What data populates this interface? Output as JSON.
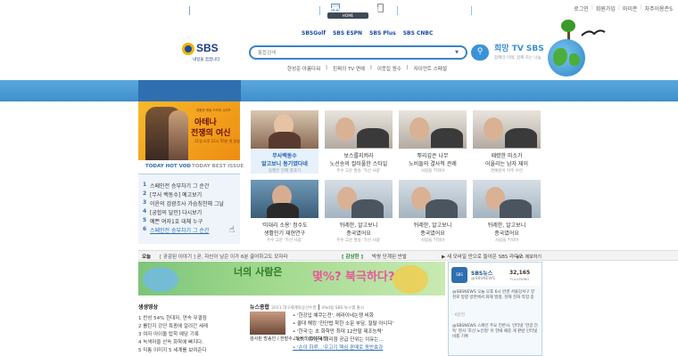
{
  "top": {
    "home_tab": "HOME",
    "links": [
      "로그인",
      "회원가입",
      "마이존",
      "자주이용존S"
    ]
  },
  "header": {
    "logo": "SBS",
    "logo_sub": "내일을 꿈꿉니다",
    "brands": [
      "SBSGolf",
      "SBS ESPN",
      "SBS Plus",
      "SBS CNBC"
    ],
    "search_placeholder": "통합검색",
    "quicklinks": [
      "한성준 아름다워",
      "진짜의 TV 연예",
      "이웃집 원수",
      "자이언트 스페셜"
    ],
    "hope_title": "희망 TV SBS",
    "hope_sub": "함께라 미래, 함께 하는 나눔"
  },
  "nav": {
    "left": [
      "온에어",
      "편성표"
    ],
    "group1": [
      "TV",
      "라디오",
      "뉴스"
    ],
    "group2": [
      "NeTV",
      "VOD",
      "콘텐"
    ],
    "group3": [
      "뮤직",
      "게임",
      "영화"
    ],
    "group4": [
      "프로그램 바로가기"
    ]
  },
  "promo": {
    "line": "영원한 애정 드라마 시리즈",
    "title1": "아테나",
    "title2": "전쟁의 여신",
    "sub": "11일 오후 11시 55분 첫 방송"
  },
  "tabs": {
    "left": "TODAY HOT VOD",
    "right": "TODAY BEST ISSUE"
  },
  "ranking": [
    {
      "n": "1",
      "t": "스페인전 승부차기 그 순간"
    },
    {
      "n": "2",
      "t": "[무사 백동수] 예고보기"
    },
    {
      "n": "3",
      "t": "이윤의 검광조사 가슴칭찬해 그날"
    },
    {
      "n": "4",
      "t": "[궁합의 달인] 다시보기"
    },
    {
      "n": "5",
      "t": "예쁜 여자1호 대체 누구"
    },
    {
      "n": "6",
      "t": "스페인전 승부차기 그 순간"
    }
  ],
  "videos": [
    {
      "c1": "무사백동수",
      "c2": "알고보니 동기였다네",
      "c3": "동행은 언제 결과기"
    },
    {
      "c1": "보스를지켜라",
      "c2": "노선송의 컬러풀한 스타일",
      "c3": "주수 고운 발송 '가선 사람'"
    },
    {
      "c1": "뿌리깊은 나무",
      "c2": "노비들의 결사적 관례",
      "c3": "사람을 키워야"
    },
    {
      "c1": "때렸한 미소가",
      "c2": "어울리는 남자 재이",
      "c3": "연예원이 아주 수안"
    },
    {
      "c1": "'미대리 소용' 정수도",
      "c2": "생활인기 재현연구",
      "c3": "주수 고운 '가선 사람'"
    },
    {
      "c1": "뒤레한, 알고보니",
      "c2": "종국였어요",
      "c3": "주수 고운 발송 '가선 사람'"
    },
    {
      "c1": "뒤레한, 알고보니",
      "c2": "종국였어요",
      "c3": "사람을 키워야"
    },
    {
      "c1": "뒤레한, 알고보니",
      "c2": "종국였어요",
      "c3": "사람을 키워야"
    },
    {
      "c1": "뒤대타른 공방전 중의",
      "c2": "한국운의 테츠모습",
      "c3": "연예원이 아주 수안"
    }
  ],
  "ticker": {
    "label": "오늘",
    "item1": "[ 공감된 이야기 ] 곧, 자신이 남은 이가 6분 끌어하고도 모자라",
    "badge": "[ 감상한 ]",
    "item2": "박쌍 단계된 반발",
    "item3": "▶ 새 모바일 만으로 들어온 SBS 라디오"
  },
  "banner": {
    "t1": "너의 사람은",
    "t2": "몇%? 북극하다?"
  },
  "sbsbox": {
    "news_btn": "뉴스 제보하기",
    "name": "SBS뉴스",
    "handle": "@SBSNEWS",
    "count": "32,165",
    "count_label": "FOLLOWING",
    "tweets": [
      "@SBSNEWS 오늘 오후 6시 반경 서울강서구 양천로 방향 방면에서 화재 발생, 현재 진화 작업 중",
      "· 6분전",
      "@SBSNEWS 스페인 주요 언론사, 인터넷 '한글 단독' 영사 '조선 노인정' 이 한때 때증 게 판련 인터넷 비를 기록"
    ]
  },
  "bottom": {
    "left_title": "생생영상",
    "left_items": [
      "찬성 54% 한대자, 연속 무결점",
      "롤틴지 강단 특종에 알려간 세례",
      "여자 아이돌 탑학 예담 기록",
      "녹색마을 산속 화학에 빠지다.",
      "미통 이미지 5 세계를 보여준다"
    ],
    "news_title": "뉴스종합",
    "news_date": "2011 대구세계육상선수권",
    "news_sub": "iPad용 SBS 뉴스앱 출시",
    "news_items": [
      "'한강입 예쿠는전', 에라이네논쟁 비화",
      "콜대 해킹 '진단법 학한 소문 부담, 절탈 아니다'",
      "'한국'는 초 화학만 최대 12만팔 제조능력'",
      "KT, 아이폰4 대리점 공급 단위는 이유는…",
      "'손이 하루...'우고기 핵심 판매로 동반효과"
    ],
    "news_cap": "검사된 방송인 / 한발수 '죄개리 법이 박진'"
  },
  "colors": {
    "accent": "#3a93d8",
    "nav": "#4a9bd5",
    "brand": "#1a3a8c"
  }
}
